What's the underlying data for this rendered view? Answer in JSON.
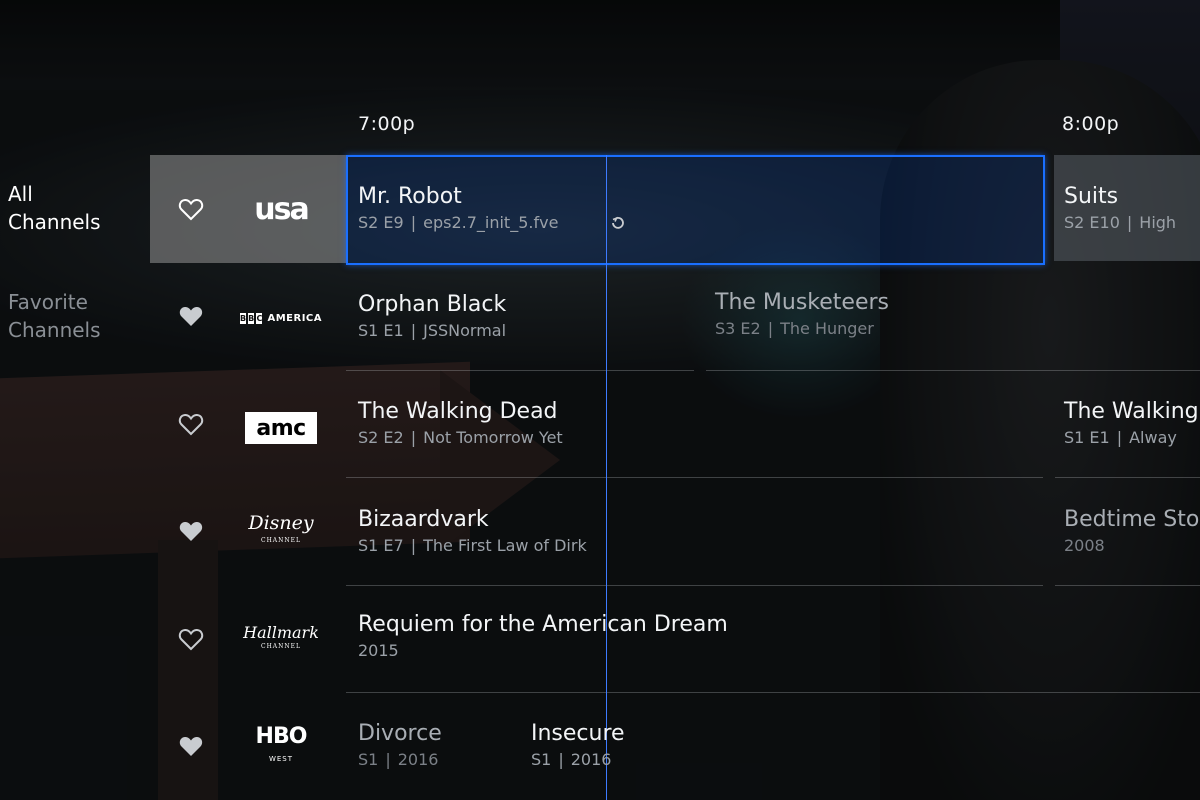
{
  "timeline": {
    "slots": [
      "7:00p",
      "8:00p"
    ]
  },
  "side_nav": {
    "items": [
      {
        "label_line1": "All",
        "label_line2": "Channels",
        "active": true
      },
      {
        "label_line1": "Favorite",
        "label_line2": "Channels",
        "active": false
      }
    ]
  },
  "channels": [
    {
      "logo_text": "usa",
      "favorite": false,
      "logo_icon": "usa-logo",
      "programs": [
        {
          "title": "Mr. Robot",
          "season_episode": "S2 E9",
          "episode": "eps2.7_init_5.fve",
          "selected": true
        },
        {
          "title": "Suits",
          "season_episode": "S2 E10",
          "episode": "High"
        }
      ]
    },
    {
      "logo_text": "BBC",
      "logo_sub": "AMERICA",
      "favorite": true,
      "logo_icon": "bbc-america-logo",
      "programs": [
        {
          "title": "Orphan Black",
          "season_episode": "S1 E1",
          "episode": "JSSNormal"
        },
        {
          "title": "The Musketeers",
          "season_episode": "S3 E2",
          "episode": "The Hunger"
        }
      ]
    },
    {
      "logo_text": "amc",
      "favorite": false,
      "logo_icon": "amc-logo",
      "programs": [
        {
          "title": "The Walking Dead",
          "season_episode": "S2 E2",
          "episode": "Not Tomorrow Yet"
        },
        {
          "title": "The Walking",
          "season_episode": "S1 E1",
          "episode": "Alway"
        }
      ]
    },
    {
      "logo_text": "Disney",
      "logo_sub": "CHANNEL",
      "favorite": true,
      "logo_icon": "disney-channel-logo",
      "programs": [
        {
          "title": "Bizaardvark",
          "season_episode": "S1 E7",
          "episode": "The First Law of Dirk"
        },
        {
          "title": "Bedtime Sto",
          "year": "2008"
        }
      ]
    },
    {
      "logo_text": "Hallmark",
      "logo_sub": "CHANNEL",
      "favorite": false,
      "logo_icon": "hallmark-channel-logo",
      "programs": [
        {
          "title": "Requiem for the American Dream",
          "year": "2015"
        }
      ]
    },
    {
      "logo_text": "HBO",
      "logo_sub": "WEST",
      "favorite": true,
      "logo_icon": "hbo-west-logo",
      "programs": [
        {
          "title": "Divorce",
          "season": "S1",
          "year": "2016"
        },
        {
          "title": "Insecure",
          "season": "S1",
          "year": "2016"
        }
      ]
    }
  ],
  "colors": {
    "selection_border": "#1a6fff",
    "now_line": "#3e7bff",
    "channel_highlight": "#969696"
  },
  "icons": {
    "favorite": "heart-icon",
    "replay": "replay-icon"
  }
}
